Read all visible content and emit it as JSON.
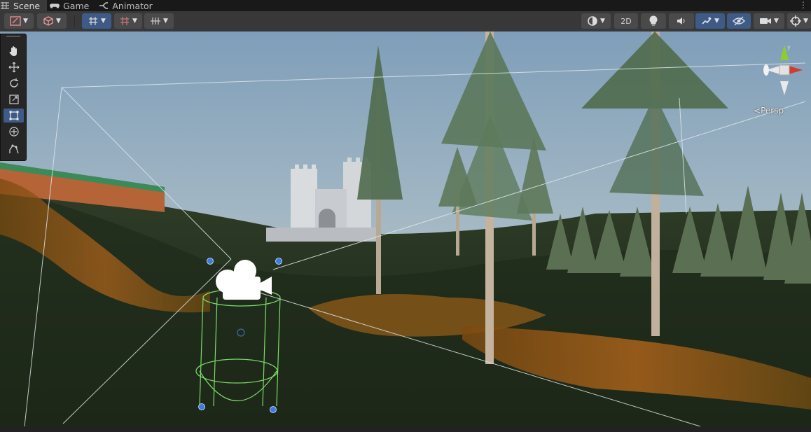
{
  "tabs": [
    {
      "label": "Scene",
      "icon": "grid-icon",
      "active": true
    },
    {
      "label": "Game",
      "icon": "gamepad-icon",
      "active": false
    },
    {
      "label": "Animator",
      "icon": "animator-icon",
      "active": false
    }
  ],
  "toolbar": {
    "view_2d_label": "2D",
    "left_buttons": [
      "draw-mode",
      "render-mode",
      "grid-snap",
      "increment-snap",
      "align-grid"
    ],
    "right_buttons": [
      "orientation",
      "2d-toggle",
      "lighting",
      "audio",
      "effects",
      "visibility",
      "camera",
      "gizmos"
    ]
  },
  "tools": [
    "hand-tool",
    "move-tool",
    "rotate-tool",
    "scale-tool",
    "rect-tool",
    "transform-tool",
    "custom-tool"
  ],
  "selected_tool": "rect-tool",
  "view": {
    "projection_label": "Persp",
    "gizmo_axes": [
      "y",
      "x",
      "z"
    ]
  },
  "scene": {
    "sky_top": "#8aa7c0",
    "sky_bottom": "#b9c6c8",
    "ground": "#1f2d1a",
    "selection": "#3d5b86"
  }
}
